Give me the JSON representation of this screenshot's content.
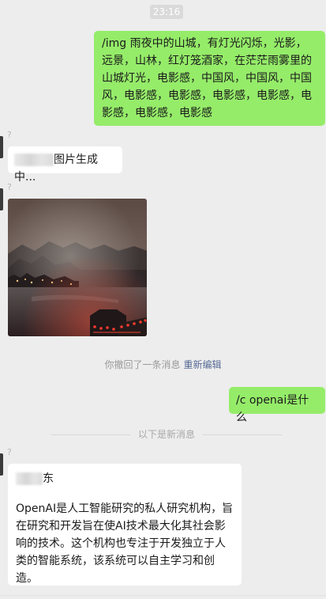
{
  "timestamp": "23:16",
  "messages": {
    "prompt": "/img 雨夜中的山城，有灯光闪烁，光影，远景，山林，红灯笼酒家，在茫茫雨雾里的山城灯光，电影感，中国风，中国风，中国风，电影感，电影感，电影感，电影感，电影感，电影感，电影感",
    "generating": "图片生成中...",
    "image_alt": "rainy night mountain town image",
    "recall_text": "你撤回了一条消息",
    "recall_action": "重新编辑",
    "question": "/c openai是什么",
    "divider_text": "以下是新消息",
    "sender_suffix": "东",
    "answer": "OpenAI是人工智能研究的私人研究机构，旨在研究和开发旨在使AI技术最大化其社会影响的技术。这个机构也专注于开发独立于人类的智能系统，该系统可以自主学习和创造。"
  },
  "unknown_marker": "?",
  "colors": {
    "background": "#ededed",
    "sent_bubble": "#95ec69",
    "received_bubble": "#ffffff",
    "link": "#576b95"
  }
}
